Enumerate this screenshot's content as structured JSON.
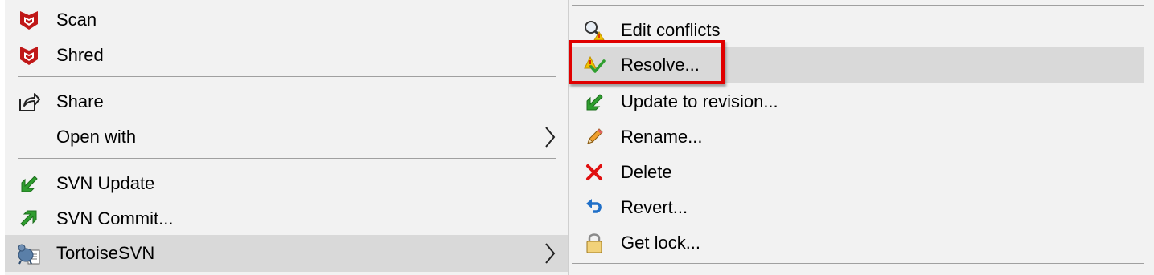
{
  "left_menu": {
    "items": [
      {
        "label": "Scan",
        "icon": "mcafee-shield-icon"
      },
      {
        "label": "Shred",
        "icon": "mcafee-shield-icon"
      },
      {
        "label": "Share",
        "icon": "share-icon"
      },
      {
        "label": "Open with",
        "icon": ""
      },
      {
        "label": "SVN Update",
        "icon": "svn-update-icon"
      },
      {
        "label": "SVN Commit...",
        "icon": "svn-commit-icon"
      },
      {
        "label": "TortoiseSVN",
        "icon": "tortoisesvn-icon"
      }
    ]
  },
  "right_menu": {
    "items": [
      {
        "label": "Edit conflicts",
        "icon": "edit-conflicts-icon"
      },
      {
        "label": "Resolve...",
        "icon": "resolve-icon"
      },
      {
        "label": "Update to revision...",
        "icon": "update-revision-icon"
      },
      {
        "label": "Rename...",
        "icon": "rename-pencil-icon"
      },
      {
        "label": "Delete",
        "icon": "delete-x-icon"
      },
      {
        "label": "Revert...",
        "icon": "revert-icon"
      },
      {
        "label": "Get lock...",
        "icon": "lock-icon"
      }
    ]
  },
  "colors": {
    "menu_bg": "#f2f2f2",
    "hover_bg": "#d9d9d9",
    "highlight_border": "#e00000",
    "mcafee_red": "#c01818",
    "svn_green": "#2f9e2f"
  }
}
